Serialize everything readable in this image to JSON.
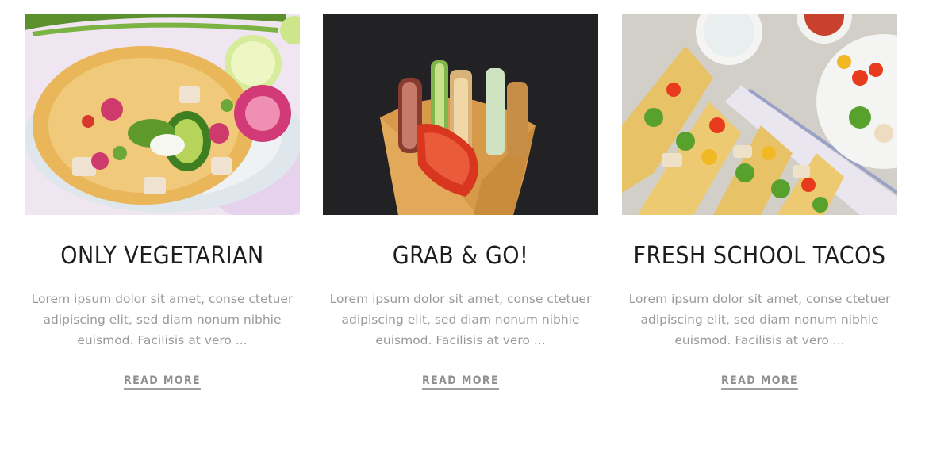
{
  "cards": [
    {
      "image_alt": "Vegetarian taco with avocado, radish and chicken",
      "title": "ONLY VEGETARIAN",
      "description": "Lorem ipsum dolor sit amet, conse ctetuer adipiscing elit, sed diam nonum nibhie euismod. Facilisis at vero ...",
      "cta": "READ MORE"
    },
    {
      "image_alt": "Grilled chicken wrap with tomato and bacon",
      "title": "GRAB & GO!",
      "description": "Lorem ipsum dolor sit amet, conse ctetuer adipiscing elit, sed diam nonum nibhie euismod. Facilisis at vero ...",
      "cta": "READ MORE"
    },
    {
      "image_alt": "Fresh tacos with salad, peppers and cherry tomatoes",
      "title": "FRESH SCHOOL TACOS",
      "description": "Lorem ipsum dolor sit amet, conse ctetuer adipiscing elit, sed diam nonum nibhie euismod. Facilisis at vero ...",
      "cta": "READ MORE"
    }
  ]
}
